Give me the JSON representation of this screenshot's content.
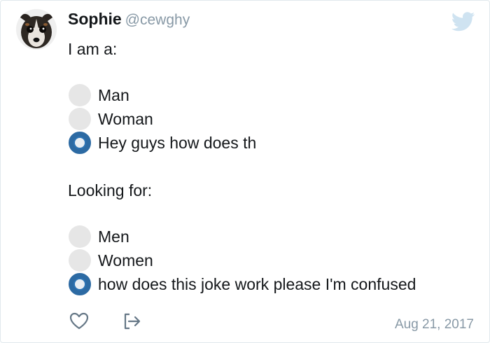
{
  "tweet": {
    "display_name": "Sophie",
    "handle": "@cewghy",
    "intro": "I am a:",
    "section2": "Looking for:",
    "date": "Aug 21, 2017"
  },
  "poll1": {
    "options": [
      {
        "label": "Man",
        "selected": false
      },
      {
        "label": "Woman",
        "selected": false
      },
      {
        "label": "Hey guys how does th",
        "selected": true
      }
    ]
  },
  "poll2": {
    "options": [
      {
        "label": "Men",
        "selected": false
      },
      {
        "label": "Women",
        "selected": false
      },
      {
        "label": "how does this joke work please I'm confused",
        "selected": true
      }
    ]
  },
  "icons": {
    "brand": "twitter-bird-icon",
    "like": "heart-icon",
    "share": "share-icon"
  },
  "colors": {
    "selected_radio": "#2c73b4",
    "unselected_radio": "#e6e6e6",
    "muted_text": "#8899a6",
    "brand_bird": "#cfe3f1"
  }
}
